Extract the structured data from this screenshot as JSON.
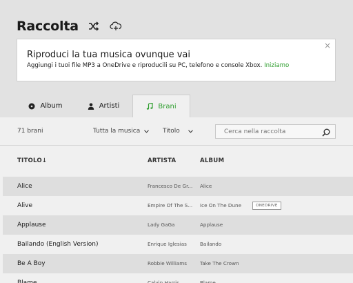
{
  "header": {
    "title": "Raccolta",
    "shuffle_icon": "shuffle-icon",
    "cloud_icon": "cloud-add-icon"
  },
  "banner": {
    "title": "Riproduci la tua musica ovunque vai",
    "text": "Aggiungi i tuoi file MP3 a OneDrive e riproducili su PC, telefono e console Xbox.",
    "link": "Iniziamo",
    "close": "×"
  },
  "tabs": [
    {
      "label": "Album",
      "icon": "disc-icon"
    },
    {
      "label": "Artisti",
      "icon": "person-icon"
    },
    {
      "label": "Brani",
      "icon": "music-note-icon",
      "active": true
    }
  ],
  "filters": {
    "count": "71 brani",
    "source": "Tutta la musica",
    "sort": "Titolo",
    "search_placeholder": "Cerca nella raccolta"
  },
  "columns": {
    "title": "TITOLO",
    "artist": "ARTISTA",
    "album": "ALBUM"
  },
  "songs": [
    {
      "title": "Alice",
      "artist": "Francesco De Gr...",
      "album": "Alice",
      "badge": ""
    },
    {
      "title": "Alive",
      "artist": "Empire Of The S...",
      "album": "Ice On The Dune",
      "badge": "ONEDRIVE"
    },
    {
      "title": "Applause",
      "artist": "Lady GaGa",
      "album": "Applause",
      "badge": ""
    },
    {
      "title": "Bailando (English Version)",
      "artist": "Enrique Iglesias",
      "album": "Bailando",
      "badge": ""
    },
    {
      "title": "Be A Boy",
      "artist": "Robbie Williams",
      "album": "Take The Crown",
      "badge": ""
    },
    {
      "title": "Blame",
      "artist": "Calvin Harris",
      "album": "Blame",
      "badge": ""
    }
  ],
  "colors": {
    "accent": "#2e9e2e",
    "background": "#e2e2e2",
    "content": "#f0f0f0",
    "alt_row": "#dedede"
  }
}
